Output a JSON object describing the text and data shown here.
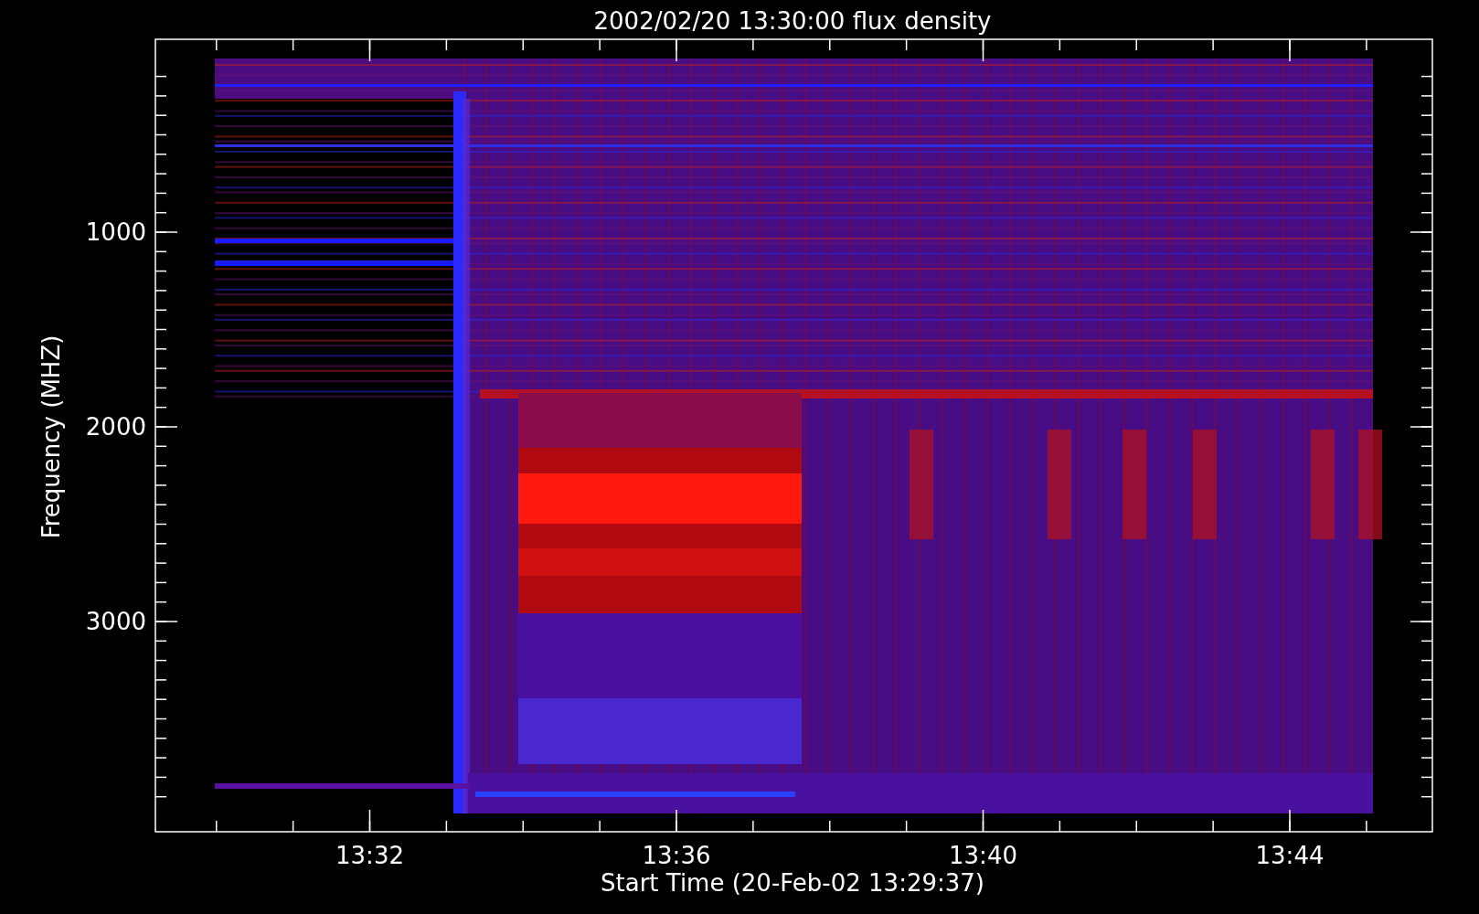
{
  "title": "2002/02/20 13:30:00 flux density",
  "y_axis": {
    "label": "Frequency (MHZ)",
    "ticks": [
      "1000",
      "2000",
      "3000"
    ]
  },
  "x_axis": {
    "label": "Start Time (20-Feb-02 13:29:37)",
    "ticks": [
      "13:32",
      "13:36",
      "13:40",
      "13:44"
    ]
  }
}
